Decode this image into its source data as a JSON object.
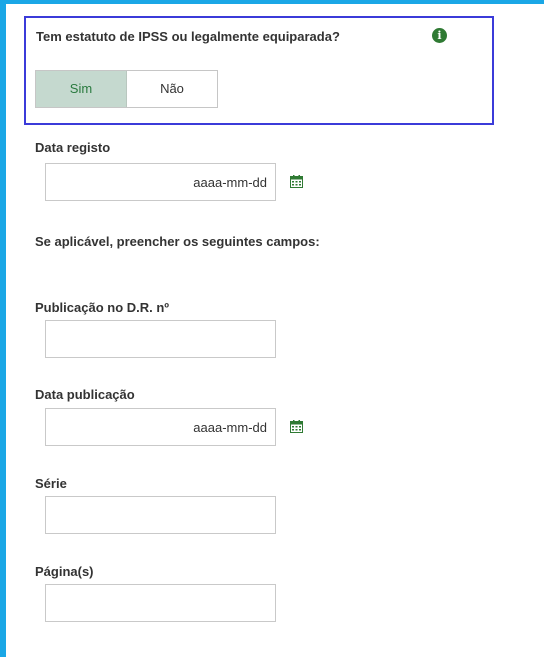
{
  "ipss": {
    "question": "Tem estatuto de IPSS ou legalmente equiparada?",
    "info_icon": "info-icon",
    "options": [
      "Sim",
      "Não"
    ],
    "selected": "Sim"
  },
  "data_registo": {
    "label": "Data registo",
    "placeholder": "aaaa-mm-dd",
    "icon": "calendar-icon"
  },
  "note": "Se aplicável, preencher os seguintes campos:",
  "publicacao": {
    "label": "Publicação no D.R. nº",
    "value": ""
  },
  "data_publicacao": {
    "label": "Data publicação",
    "placeholder": "aaaa-mm-dd",
    "icon": "calendar-icon"
  },
  "serie": {
    "label": "Série",
    "value": ""
  },
  "paginas": {
    "label": "Página(s)",
    "value": ""
  },
  "colors": {
    "frame": "#1aa7e6",
    "highlight": "#3b3bd9",
    "accent_green": "#2f7a33",
    "toggle_selected_bg": "#c5d9cf"
  }
}
